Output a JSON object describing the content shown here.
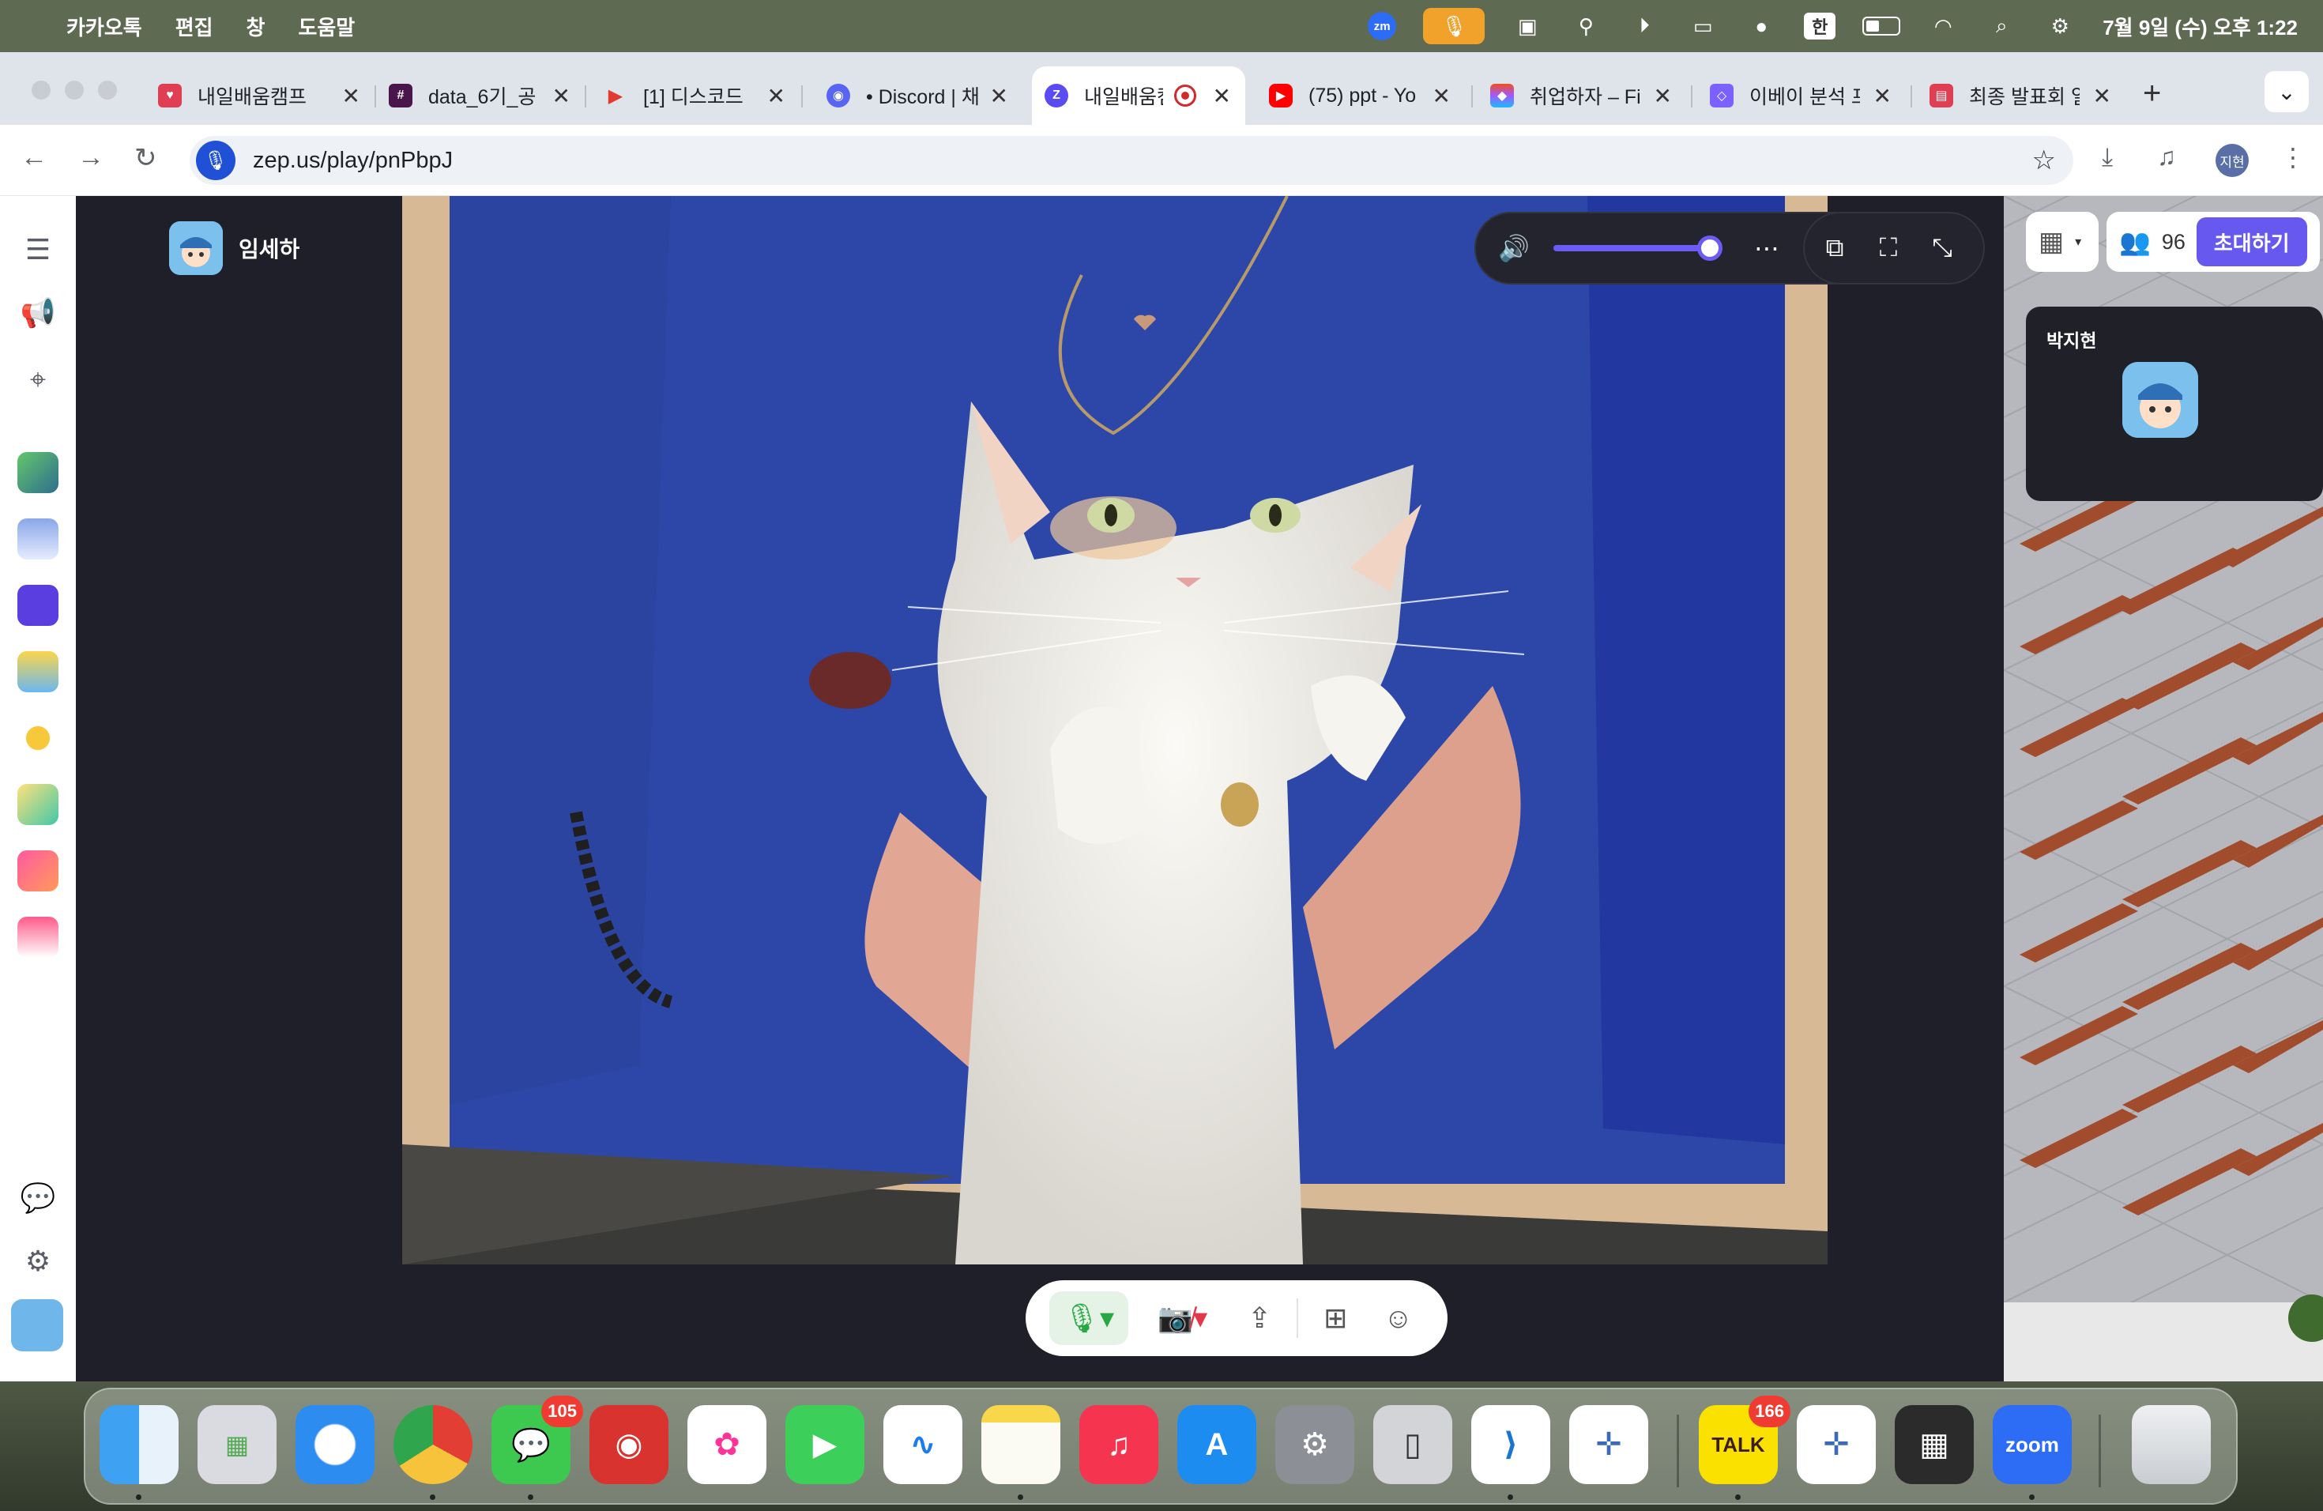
{
  "menubar": {
    "app_name": "카카오톡",
    "menus": [
      "편집",
      "창",
      "도움말"
    ],
    "zoom_label": "zm",
    "input_source": "한",
    "clock": "7월 9일 (수) 오후 1:22"
  },
  "browser": {
    "tabs": [
      {
        "title": "내일배움캠프",
        "color": "#e03e52"
      },
      {
        "title": "data_6기_공",
        "color": "#4a154b"
      },
      {
        "title": "[1] 디스코드",
        "color": "#e23a2e"
      },
      {
        "title": "• Discord | 채",
        "color": "#5865f2"
      },
      {
        "title": "내일배움캠",
        "color": "#5a4cf0"
      },
      {
        "title": "(75) ppt - Yo",
        "color": "#ff0000"
      },
      {
        "title": "취업하자 – Fi",
        "color": "#a259ff"
      },
      {
        "title": "이베이 분석 프",
        "color": "#7b61ff"
      },
      {
        "title": "최종 발표회 일",
        "color": "#e03e52"
      }
    ],
    "new_tab": "+",
    "url": "zep.us/play/pnPbpJ",
    "profile_initial": "지현"
  },
  "zep": {
    "speaker_name": "임세하",
    "volume": 1.0,
    "participants_count": "96",
    "invite_label": "초대하기",
    "peer_name": "박지현"
  },
  "dock": {
    "messages_badge": "105",
    "kakaotalk_badge": "166",
    "kakaotalk_label": "TALK",
    "zoom_label": "zoom"
  },
  "colors": {
    "accent": "#6758f0",
    "menubar": "#5f6a52",
    "stage_bg": "#1e1f28"
  }
}
